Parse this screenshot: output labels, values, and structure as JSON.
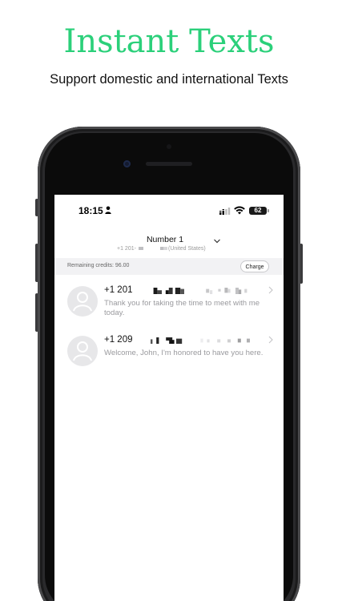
{
  "promo": {
    "title": "Instant Texts",
    "subtitle": "Support domestic and international Texts"
  },
  "status_bar": {
    "time": "18:15",
    "battery": "62"
  },
  "number_selector": {
    "name": "Number 1",
    "number_prefix": "+1 201-",
    "country": "(United States)"
  },
  "credits": {
    "label": "Remaining credits: 96.00",
    "charge_label": "Charge"
  },
  "conversations": [
    {
      "number": "+1 201",
      "preview": "Thank you for taking the time to meet with me today."
    },
    {
      "number": "+1 209",
      "preview": "Welcome, John, I'm honored to have you here."
    }
  ],
  "colors": {
    "accent": "#2bd07a"
  }
}
